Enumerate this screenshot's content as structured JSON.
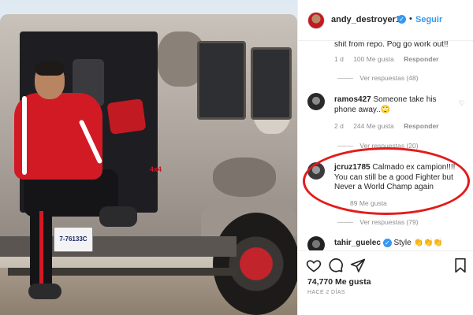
{
  "post": {
    "author": "andy_destroyer13",
    "follow_label": "Seguir",
    "separator": "•",
    "plate_text": "7-76133C",
    "badge_text": "4x4",
    "likes": "74,770 Me gusta",
    "time": "HACE 2 DÍAS"
  },
  "comments": [
    {
      "text": "shit from repo. Pog go work out!!",
      "time": "1 d",
      "likes": "100 Me gusta",
      "reply": "Responder",
      "view_replies": "Ver respuestas (48)"
    },
    {
      "user": "ramos427",
      "text": "Someone take his phone away..🙄",
      "time": "2 d",
      "likes": "244 Me gusta",
      "reply": "Responder",
      "view_replies": "Ver respuestas (20)"
    },
    {
      "user": "jcruz1785",
      "text": "Calmado ex campion!!!! You can still be a good Fighter but Never a World Champ again",
      "likes": "89 Me gusta",
      "view_replies": "Ver respuestas (79)"
    },
    {
      "user": "tahir_guelec",
      "text": "Style 👏👏👏"
    }
  ],
  "icons": {
    "like": "heart-icon",
    "comment": "comment-icon",
    "share": "share-icon",
    "save": "bookmark-icon",
    "verified": "verified-icon"
  },
  "colors": {
    "accent": "#3897f0",
    "highlight": "#e31b1b",
    "muted": "#8e8e8e"
  }
}
